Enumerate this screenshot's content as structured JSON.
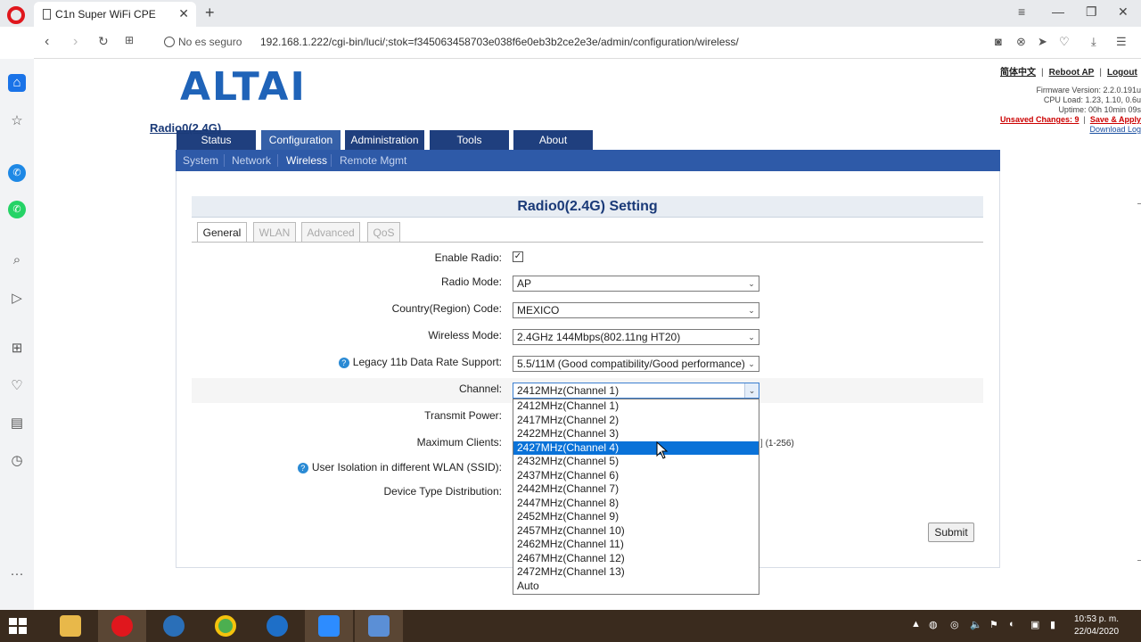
{
  "browser": {
    "tab_title": "C1n Super WiFi CPE",
    "new_tab": "+",
    "close_tab": "✕",
    "security": "No es seguro",
    "url": "192.168.1.222/cgi-bin/luci/;stok=f345063458703e038f6e0eb3b2ce2e3e/admin/configuration/wireless/",
    "win_min": "—",
    "win_max": "❐",
    "win_close": "✕"
  },
  "header": {
    "logo": "ALTAI",
    "lang_link": "简体中文",
    "reboot_link": "Reboot AP",
    "logout_link": "Logout",
    "firmware": "Firmware Version: 2.2.0.191u",
    "cpu_load": "CPU Load: 1.23, 1.10, 0.6u",
    "uptime": "Uptime: 00h 10min 09s",
    "unsaved": "Unsaved Changes: 9",
    "save_apply": "Save & Apply",
    "download_log": "Download Log"
  },
  "main_tabs": [
    "Status",
    "Configuration",
    "Administration",
    "Tools",
    "About"
  ],
  "sub_nav": [
    "System",
    "Network",
    "Wireless",
    "Remote Mgmt"
  ],
  "radio_link": "Radio0(2.4G)",
  "setting_title": "Radio0(2.4G) Setting",
  "sub_tabs": [
    "General",
    "WLAN",
    "Advanced",
    "QoS"
  ],
  "form": {
    "enable_radio": "Enable Radio:",
    "enable_radio_checked": true,
    "radio_mode": "Radio Mode:",
    "radio_mode_value": "AP",
    "country": "Country(Region) Code:",
    "country_value": "MEXICO",
    "wireless_mode": "Wireless Mode:",
    "wireless_mode_value": "2.4GHz 144Mbps(802.11ng HT20)",
    "legacy": "Legacy 11b Data Rate Support:",
    "legacy_value": "5.5/11M (Good compatibility/Good performance)",
    "channel": "Channel:",
    "channel_value": "2412MHz(Channel 1)",
    "transmit_power": "Transmit Power:",
    "max_clients": "Maximum Clients:",
    "max_clients_range": "(1-256)",
    "user_isolation": "User Isolation in different WLAN (SSID):",
    "device_dist": "Device Type Distribution:",
    "submit": "Submit"
  },
  "channel_options": [
    "2412MHz(Channel 1)",
    "2417MHz(Channel 2)",
    "2422MHz(Channel 3)",
    "2427MHz(Channel 4)",
    "2432MHz(Channel 5)",
    "2437MHz(Channel 6)",
    "2442MHz(Channel 7)",
    "2447MHz(Channel 8)",
    "2452MHz(Channel 9)",
    "2457MHz(Channel 10)",
    "2462MHz(Channel 11)",
    "2467MHz(Channel 12)",
    "2472MHz(Channel 13)",
    "Auto"
  ],
  "highlighted_option": "2427MHz(Channel 4)",
  "taskbar": {
    "time": "10:53 p. m.",
    "date": "22/04/2020"
  },
  "colors": {
    "brand": "#1f63b8",
    "nav_dark": "#1f3f7e",
    "nav_active": "#3560a8",
    "subnav": "#2e5aa8",
    "selection": "#0a72d8",
    "warning": "#cc0000"
  }
}
